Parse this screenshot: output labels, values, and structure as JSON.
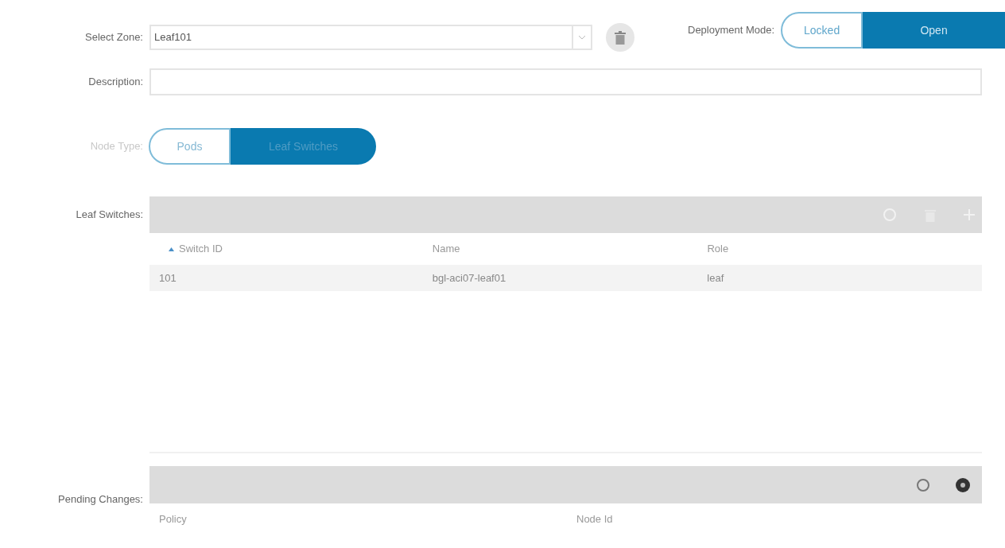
{
  "zone": {
    "label": "Select Zone:",
    "value": "Leaf101"
  },
  "deployment_mode": {
    "label": "Deployment Mode:",
    "options": [
      {
        "label": "Locked",
        "selected": false
      },
      {
        "label": "Open",
        "selected": true
      }
    ]
  },
  "description": {
    "label": "Description:"
  },
  "node_type": {
    "label": "Node Type:",
    "disabled": true,
    "options": [
      {
        "label": "Pods",
        "selected": false
      },
      {
        "label": "Leaf Switches",
        "selected": true
      }
    ]
  },
  "leaf_switches": {
    "label": "Leaf Switches:",
    "columns": [
      {
        "label": "Switch ID",
        "sorted": true
      },
      {
        "label": "Name",
        "sorted": false
      },
      {
        "label": "Role",
        "sorted": false
      }
    ],
    "rows": [
      [
        "101",
        "bgl-aci07-leaf01",
        "leaf"
      ]
    ]
  },
  "pending_changes": {
    "label": "Pending Changes:",
    "columns": [
      {
        "label": "Policy"
      },
      {
        "label": "Node Id"
      }
    ]
  }
}
